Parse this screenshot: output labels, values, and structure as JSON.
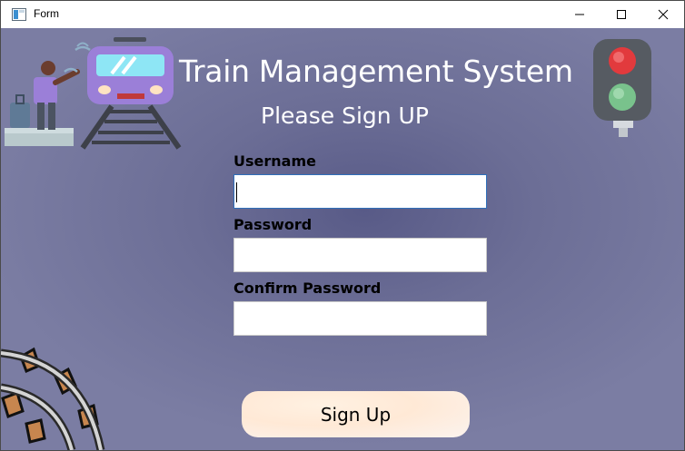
{
  "window": {
    "title": "Form",
    "controls": [
      "minimize",
      "maximize",
      "close"
    ]
  },
  "header": {
    "title": "Train Management System",
    "subtitle": "Please Sign UP"
  },
  "form": {
    "username_label": "Username",
    "username_value": "",
    "password_label": "Password",
    "password_value": "",
    "confirm_label": "Confirm Password",
    "confirm_value": "",
    "submit_label": "Sign Up",
    "focused_field": "username"
  },
  "decorations": {
    "left_illustration": "traveler-and-train-icon",
    "right_illustration": "traffic-light-icon",
    "corner_illustration": "curved-rail-track-icon"
  },
  "colors": {
    "background": "#6a6c93",
    "train_body": "#9b7fd8",
    "button_bg": "#ffe9d6",
    "focus_border": "#2f6fba"
  }
}
